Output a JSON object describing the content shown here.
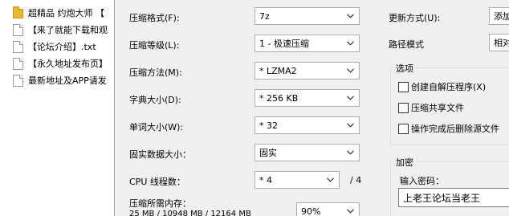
{
  "file_list": [
    {
      "type": "folder",
      "name": "超精品 约炮大师 【"
    },
    {
      "type": "file",
      "name": "【来了就能下载和观"
    },
    {
      "type": "file",
      "name": "【论坛介绍】.txt"
    },
    {
      "type": "file",
      "name": "【永久地址发布页】"
    },
    {
      "type": "file",
      "name": "最新地址及APP请发"
    }
  ],
  "settings": {
    "format_label": "压缩格式(F):",
    "format_value": "7z",
    "level_label": "压缩等级(L):",
    "level_value": "1 - 极速压缩",
    "method_label": "压缩方法(M):",
    "method_value": "* LZMA2",
    "dict_label": "字典大小(D):",
    "dict_value": "* 256 KB",
    "word_label": "单词大小(W):",
    "word_value": "* 32",
    "solid_label": "固实数据大小：",
    "solid_value": "固实",
    "cpu_label": "CPU 线程数：",
    "cpu_value": "* 4",
    "cpu_total": "/ 4",
    "memory_label": "压缩所需内存：",
    "memory_value": "25 MB / 10948 MB / 12164 MB",
    "memory_percent": "90%"
  },
  "right": {
    "update_label": "更新方式(U):",
    "update_value": "添加",
    "path_label": "路径模式",
    "path_value": "相对",
    "options_title": "选项",
    "options": [
      {
        "label": "创建自解压程序(X)",
        "checked": false
      },
      {
        "label": "压缩共享文件",
        "checked": false
      },
      {
        "label": "操作完成后删除源文件",
        "checked": false
      }
    ],
    "encrypt_title": "加密",
    "password_label": "输入密码：",
    "password_value": "上老王论坛当老王"
  }
}
